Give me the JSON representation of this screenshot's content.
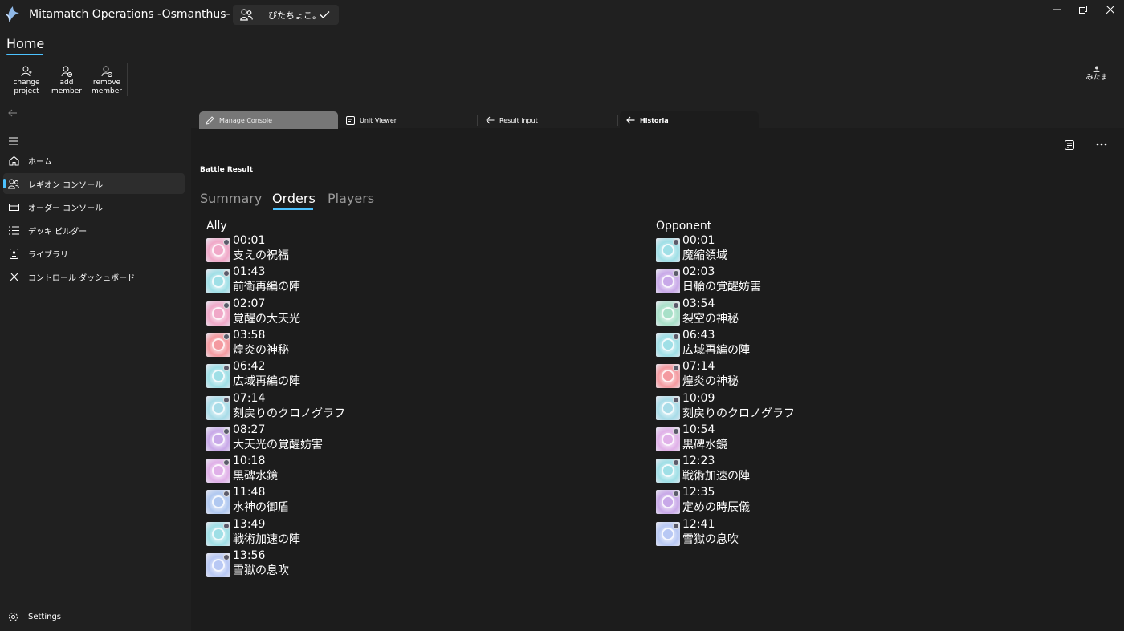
{
  "app": {
    "title": "Mitamatch Operations -Osmanthus-",
    "project_name": "ぴたちょこ。",
    "window_controls": [
      "minimize-icon",
      "restore-icon",
      "close-icon"
    ]
  },
  "home": {
    "title": "Home",
    "commands": [
      {
        "label": "change project",
        "icon": "person-swap-icon"
      },
      {
        "label": "add member",
        "icon": "person-add-icon"
      },
      {
        "label": "remove member",
        "icon": "person-remove-icon"
      }
    ],
    "user": {
      "label": "みたま",
      "icon": "avatar-icon"
    }
  },
  "nav": {
    "items": [
      {
        "label": "ホーム",
        "icon": "home-icon"
      },
      {
        "label": "レギオン コンソール",
        "icon": "people-icon",
        "active": true
      },
      {
        "label": "オーダー コンソール",
        "icon": "card-icon"
      },
      {
        "label": "デッキ ビルダー",
        "icon": "list-icon"
      },
      {
        "label": "ライブラリ",
        "icon": "library-icon"
      },
      {
        "label": "コントロール ダッシュボード",
        "icon": "control-icon"
      }
    ],
    "settings_label": "Settings"
  },
  "tabs": [
    {
      "label": "Manage Console",
      "icon": "edit-icon"
    },
    {
      "label": "Unit Viewer",
      "icon": "viewer-icon"
    },
    {
      "label": "Result input",
      "icon": "arrow-left-icon"
    },
    {
      "label": "Historia",
      "icon": "arrow-left-icon",
      "selected": true
    }
  ],
  "section_title": "Battle Result",
  "pivots": [
    {
      "label": "Summary"
    },
    {
      "label": "Orders",
      "selected": true
    },
    {
      "label": "Players"
    }
  ],
  "ally": {
    "header": "Ally",
    "orders": [
      {
        "time": "00:01",
        "name": "支えの祝福",
        "color": "#f0a8c8"
      },
      {
        "time": "01:43",
        "name": "前衛再編の陣",
        "color": "#9fdfe6"
      },
      {
        "time": "02:07",
        "name": "覚醒の大天光",
        "color": "#f0a8c8"
      },
      {
        "time": "03:58",
        "name": "煌炎の神秘",
        "color": "#f49aa0"
      },
      {
        "time": "06:42",
        "name": "広域再編の陣",
        "color": "#9fdfe6"
      },
      {
        "time": "07:14",
        "name": "刻戻りのクロノグラフ",
        "color": "#a8dce8"
      },
      {
        "time": "08:27",
        "name": "大天光の覚醒妨害",
        "color": "#c8a8e8"
      },
      {
        "time": "10:18",
        "name": "黒碑水鏡",
        "color": "#e0b0e8"
      },
      {
        "time": "11:48",
        "name": "水神の御盾",
        "color": "#b0c8f0"
      },
      {
        "time": "13:49",
        "name": "戦術加速の陣",
        "color": "#9fdfe6"
      },
      {
        "time": "13:56",
        "name": "雪獄の息吹",
        "color": "#b8c8f4"
      }
    ]
  },
  "opponent": {
    "header": "Opponent",
    "orders": [
      {
        "time": "00:01",
        "name": "魔縮領域",
        "color": "#9fdfe6"
      },
      {
        "time": "02:03",
        "name": "日輪の覚醒妨害",
        "color": "#c8a8e8"
      },
      {
        "time": "03:54",
        "name": "裂空の神秘",
        "color": "#a8e0c8"
      },
      {
        "time": "06:43",
        "name": "広域再編の陣",
        "color": "#9fdfe6"
      },
      {
        "time": "07:14",
        "name": "煌炎の神秘",
        "color": "#f49aa0"
      },
      {
        "time": "10:09",
        "name": "刻戻りのクロノグラフ",
        "color": "#a8dce8"
      },
      {
        "time": "10:54",
        "name": "黒碑水鏡",
        "color": "#e0b0e8"
      },
      {
        "time": "12:23",
        "name": "戦術加速の陣",
        "color": "#9fdfe6"
      },
      {
        "time": "12:35",
        "name": "定めの時辰儀",
        "color": "#c8a8e8"
      },
      {
        "time": "12:41",
        "name": "雪獄の息吹",
        "color": "#b8c8f4"
      }
    ]
  }
}
